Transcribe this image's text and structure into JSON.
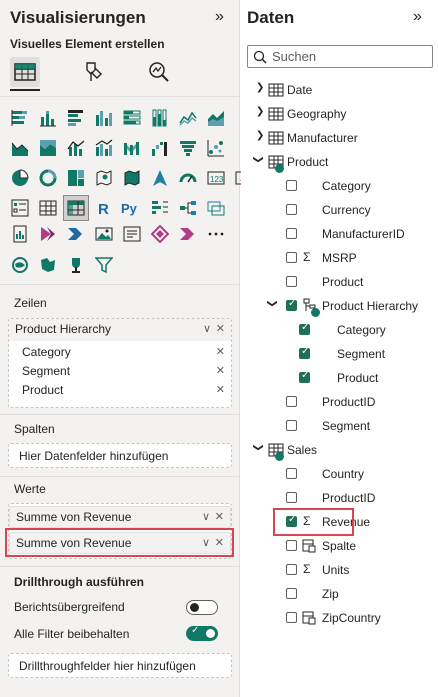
{
  "visualizations": {
    "title": "Visualisierungen",
    "collapse_icon": "»",
    "subtitle": "Visuelles Element erstellen",
    "build_tabs": [
      "table-build-icon",
      "format-brush-icon",
      "analytics-magnifier-icon"
    ],
    "gallery_icons": [
      [
        "stacked-bar-icon",
        "stacked-column-icon",
        "clustered-bar-icon",
        "clustered-column-icon",
        "100-bar-icon",
        "100-column-icon",
        "line-icon",
        "area-icon"
      ],
      [
        "stacked-area-icon",
        "100-area-icon",
        "line-column-icon",
        "line-clustered-icon",
        "ribbon-icon",
        "waterfall-icon",
        "funnel-icon",
        "scatter-icon"
      ],
      [
        "pie-icon",
        "donut-icon",
        "treemap-icon",
        "map-icon",
        "filled-map-icon",
        "azure-map-icon",
        "gauge-icon",
        "card-icon",
        "kpi-icon"
      ],
      [
        "slicer-icon",
        "table-icon",
        "matrix-icon",
        "r-script-icon",
        "python-icon",
        "key-influencers-icon",
        "decomposition-tree-icon",
        "qa-icon"
      ],
      [
        "paginated-report-icon",
        "power-apps-icon",
        "power-automate-icon",
        "image-icon",
        "narrative-icon",
        "metrics-icon",
        "goals-icon",
        "more-icon"
      ],
      [
        "arcgis-icon",
        "shape-map-icon",
        "trophy-icon",
        "filter-icon"
      ]
    ]
  },
  "wells": {
    "rows": {
      "label": "Zeilen",
      "field": "Product Hierarchy",
      "sub_fields": [
        "Category",
        "Segment",
        "Product"
      ]
    },
    "columns": {
      "label": "Spalten",
      "placeholder": "Hier Datenfelder hinzufügen"
    },
    "values": {
      "label": "Werte",
      "fields": [
        "Summe von Revenue",
        "Summe von Revenue"
      ]
    },
    "drillthrough": {
      "label": "Drillthrough ausführen",
      "cross_report_label": "Berichtsübergreifend",
      "cross_report_on": false,
      "keep_filters_label": "Alle Filter beibehalten",
      "keep_filters_on": true,
      "placeholder": "Drillthroughfelder hier hinzufügen"
    }
  },
  "data": {
    "title": "Daten",
    "collapse_icon": "»",
    "search_placeholder": "Suchen",
    "tables": [
      "Date",
      "Geography",
      "Manufacturer",
      "Product",
      "Sales"
    ],
    "product_fields": [
      "Category",
      "Currency",
      "ManufacturerID",
      "MSRP",
      "Product",
      "Product Hierarchy"
    ],
    "hierarchy_levels": [
      "Category",
      "Segment",
      "Product"
    ],
    "product_fields_after": [
      "ProductID",
      "Segment"
    ],
    "sales_fields": [
      "Country",
      "ProductID",
      "Revenue",
      "Spalte",
      "Units",
      "Zip",
      "ZipCountry"
    ]
  },
  "colors": {
    "accent_green": "#117865",
    "highlight_red": "#d64550",
    "pane_bg": "#f3f2f1"
  }
}
